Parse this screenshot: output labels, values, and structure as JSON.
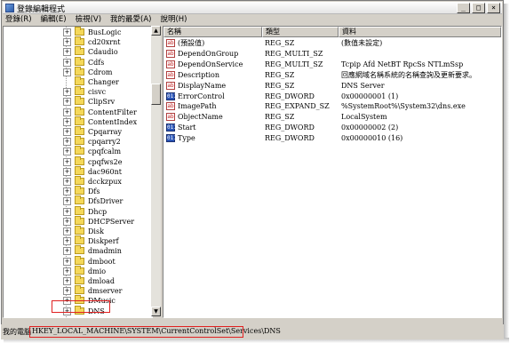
{
  "window": {
    "title": "登錄編輯程式",
    "buttons": {
      "minimize": "_",
      "maximize": "□",
      "close": "×"
    }
  },
  "menu": [
    "登錄(R)",
    "編輯(E)",
    "檢視(V)",
    "我的最愛(A)",
    "說明(H)"
  ],
  "tree": {
    "items": [
      {
        "label": "BusLogic",
        "expander": "+"
      },
      {
        "label": "cd20xrnt",
        "expander": "+"
      },
      {
        "label": "Cdaudio",
        "expander": "+"
      },
      {
        "label": "Cdfs",
        "expander": "+"
      },
      {
        "label": "Cdrom",
        "expander": "+"
      },
      {
        "label": "Changer",
        "expander": ""
      },
      {
        "label": "cisvc",
        "expander": "+"
      },
      {
        "label": "ClipSrv",
        "expander": "+"
      },
      {
        "label": "ContentFilter",
        "expander": "+"
      },
      {
        "label": "ContentIndex",
        "expander": "+"
      },
      {
        "label": "Cpqarray",
        "expander": "+"
      },
      {
        "label": "cpqarry2",
        "expander": "+"
      },
      {
        "label": "cpqfcalm",
        "expander": "+"
      },
      {
        "label": "cpqfws2e",
        "expander": "+"
      },
      {
        "label": "dac960nt",
        "expander": "+"
      },
      {
        "label": "dcckzpux",
        "expander": "+"
      },
      {
        "label": "Dfs",
        "expander": "+"
      },
      {
        "label": "DfsDriver",
        "expander": "+"
      },
      {
        "label": "Dhcp",
        "expander": "+"
      },
      {
        "label": "DHCPServer",
        "expander": "+"
      },
      {
        "label": "Disk",
        "expander": "+"
      },
      {
        "label": "Diskperf",
        "expander": "+"
      },
      {
        "label": "dmadmin",
        "expander": "+"
      },
      {
        "label": "dmboot",
        "expander": "+"
      },
      {
        "label": "dmio",
        "expander": "+"
      },
      {
        "label": "dmload",
        "expander": "+"
      },
      {
        "label": "dmserver",
        "expander": "+"
      },
      {
        "label": "DMusic",
        "expander": "+"
      },
      {
        "label": "DNS",
        "expander": "+"
      }
    ]
  },
  "columns": {
    "name": "名稱",
    "type": "類型",
    "data": "資料"
  },
  "values": [
    {
      "icon": "ab",
      "kind": "sz",
      "name": "(預設值)",
      "type": "REG_SZ",
      "data": "(數值未設定)"
    },
    {
      "icon": "ab",
      "kind": "sz",
      "name": "DependOnGroup",
      "type": "REG_MULTI_SZ",
      "data": ""
    },
    {
      "icon": "ab",
      "kind": "sz",
      "name": "DependOnService",
      "type": "REG_MULTI_SZ",
      "data": "Tcpip Afd NetBT RpcSs NTLmSsp"
    },
    {
      "icon": "ab",
      "kind": "sz",
      "name": "Description",
      "type": "REG_SZ",
      "data": "回應網域名稱系統的名稱查詢及更新要求。"
    },
    {
      "icon": "ab",
      "kind": "sz",
      "name": "DisplayName",
      "type": "REG_SZ",
      "data": "DNS Server"
    },
    {
      "icon": "011",
      "kind": "dw",
      "name": "ErrorControl",
      "type": "REG_DWORD",
      "data": "0x00000001 (1)"
    },
    {
      "icon": "ab",
      "kind": "sz",
      "name": "ImagePath",
      "type": "REG_EXPAND_SZ",
      "data": "%SystemRoot%\\System32\\dns.exe"
    },
    {
      "icon": "ab",
      "kind": "sz",
      "name": "ObjectName",
      "type": "REG_SZ",
      "data": "LocalSystem"
    },
    {
      "icon": "011",
      "kind": "dw",
      "name": "Start",
      "type": "REG_DWORD",
      "data": "0x00000002 (2)"
    },
    {
      "icon": "011",
      "kind": "dw",
      "name": "Type",
      "type": "REG_DWORD",
      "data": "0x00000010 (16)"
    }
  ],
  "status": {
    "computer": "我的電腦",
    "path": "HKEY_LOCAL_MACHINE\\SYSTEM\\CurrentControlSet\\Services\\DNS"
  },
  "colors": {
    "highlight_border": "#e02020",
    "chrome": "#d4d0c8",
    "dword_icon": "#2b56b8"
  }
}
